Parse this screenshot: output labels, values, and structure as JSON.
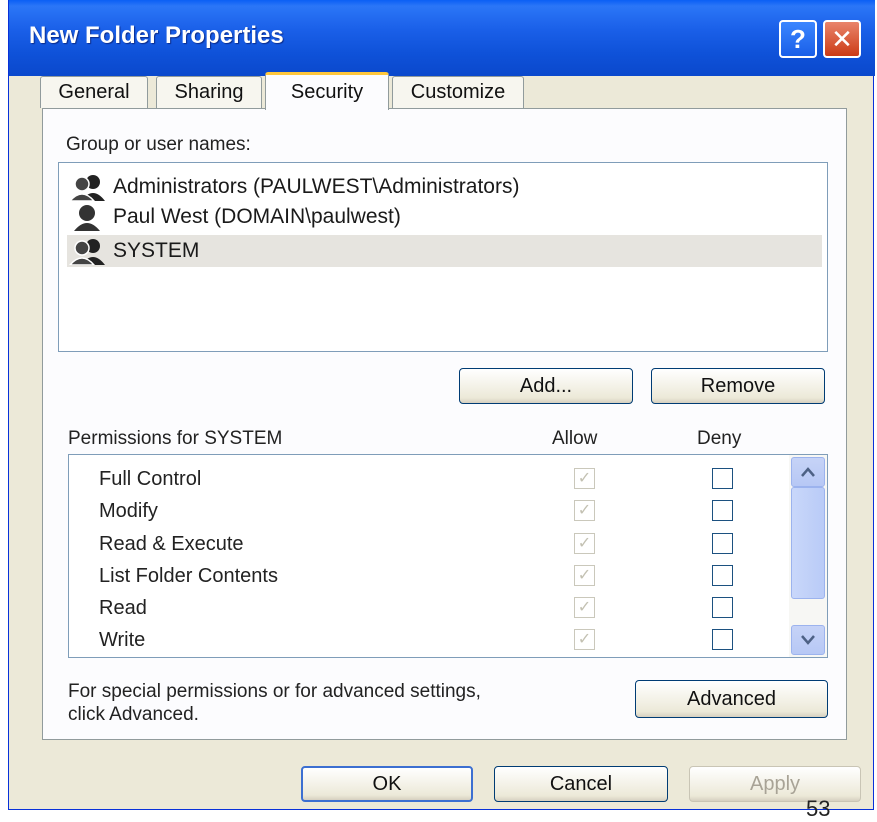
{
  "window": {
    "title": "New Folder Properties",
    "help_label": "?",
    "close_label": "✕"
  },
  "tabs": [
    {
      "label": "General",
      "active": false
    },
    {
      "label": "Sharing",
      "active": false
    },
    {
      "label": "Security",
      "active": true
    },
    {
      "label": "Customize",
      "active": false
    }
  ],
  "security": {
    "group_label": "Group or user names:",
    "users": [
      {
        "name": "Administrators (PAULWEST\\Administrators)",
        "icon": "group-icon",
        "selected": false
      },
      {
        "name": "Paul West (DOMAIN\\paulwest)",
        "icon": "user-icon",
        "selected": false
      },
      {
        "name": "SYSTEM",
        "icon": "group-icon",
        "selected": true
      }
    ],
    "add_label": "Add...",
    "remove_label": "Remove",
    "permissions_label": "Permissions for SYSTEM",
    "allow_header": "Allow",
    "deny_header": "Deny",
    "permissions": [
      {
        "name": "Full Control",
        "allow": true,
        "deny": false
      },
      {
        "name": "Modify",
        "allow": true,
        "deny": false
      },
      {
        "name": "Read & Execute",
        "allow": true,
        "deny": false
      },
      {
        "name": "List Folder Contents",
        "allow": true,
        "deny": false
      },
      {
        "name": "Read",
        "allow": true,
        "deny": false
      },
      {
        "name": "Write",
        "allow": true,
        "deny": false
      }
    ],
    "advanced_note_line1": "For special permissions or for advanced settings,",
    "advanced_note_line2": "click Advanced.",
    "advanced_label": "Advanced"
  },
  "footer": {
    "ok_label": "OK",
    "cancel_label": "Cancel",
    "apply_label": "Apply"
  },
  "page_number": "53"
}
